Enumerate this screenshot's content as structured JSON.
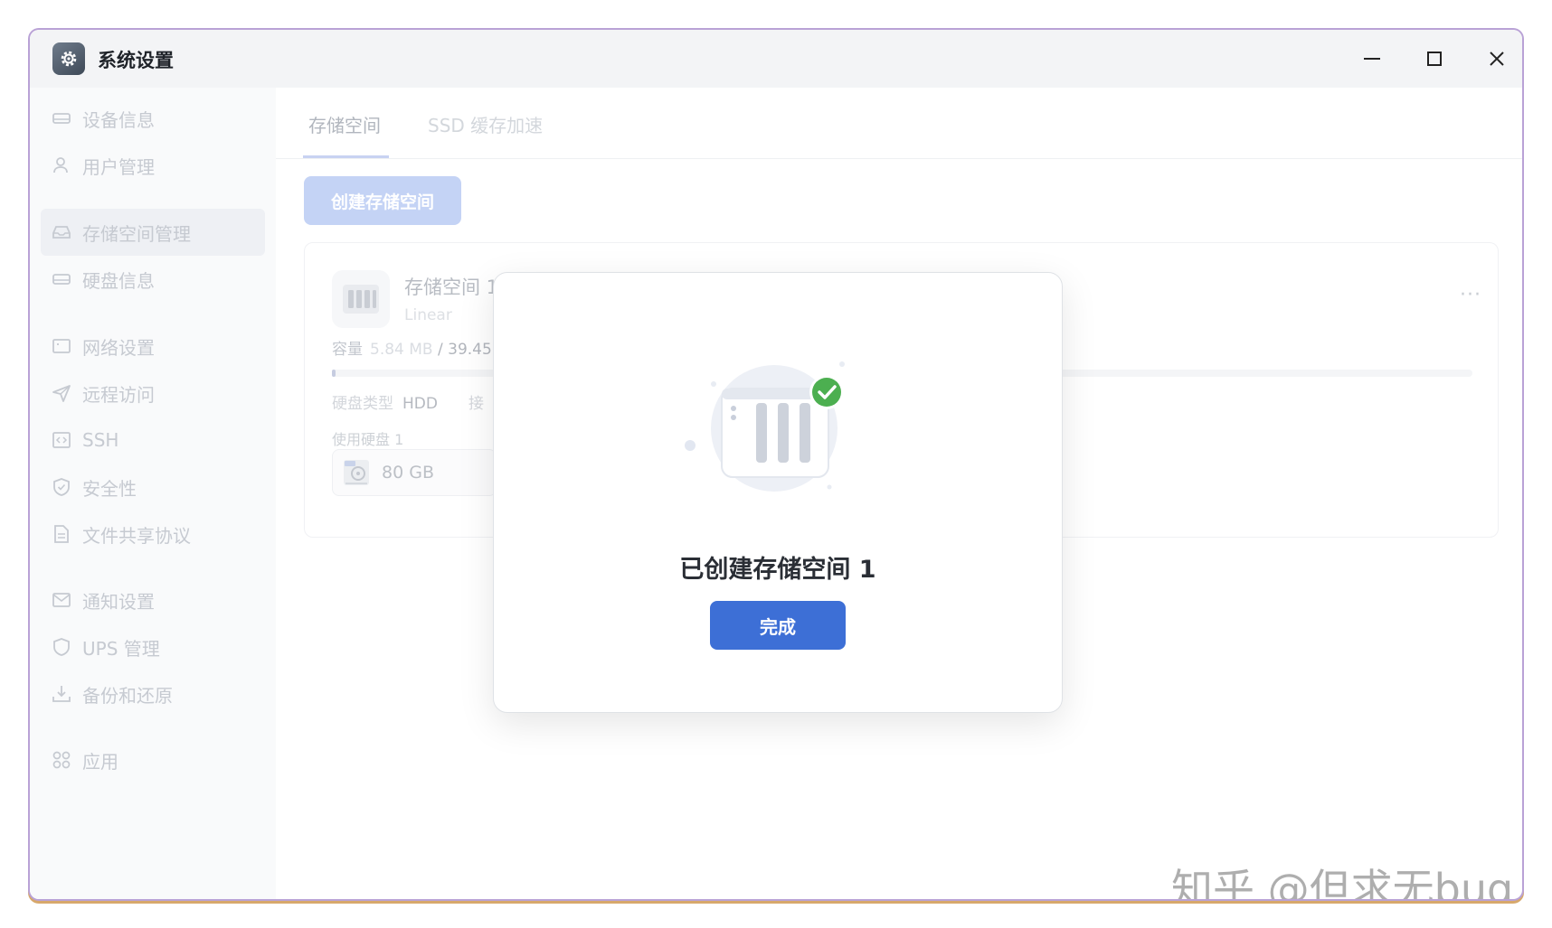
{
  "window": {
    "title": "系统设置",
    "icon": "gear-icon"
  },
  "sidebar": {
    "items": [
      {
        "label": "设备信息",
        "icon": "device-icon"
      },
      {
        "label": "用户管理",
        "icon": "user-icon"
      },
      {
        "label": "存储空间管理",
        "icon": "storage-icon",
        "active": true
      },
      {
        "label": "硬盘信息",
        "icon": "disk-icon"
      },
      {
        "label": "网络设置",
        "icon": "network-icon"
      },
      {
        "label": "远程访问",
        "icon": "send-icon"
      },
      {
        "label": "SSH",
        "icon": "ssh-icon"
      },
      {
        "label": "安全性",
        "icon": "shield-check-icon"
      },
      {
        "label": "文件共享协议",
        "icon": "file-icon"
      },
      {
        "label": "通知设置",
        "icon": "mail-icon"
      },
      {
        "label": "UPS 管理",
        "icon": "shield-icon"
      },
      {
        "label": "备份和还原",
        "icon": "download-icon"
      },
      {
        "label": "应用",
        "icon": "apps-icon"
      }
    ]
  },
  "tabs": {
    "storage": "存储空间",
    "ssd_cache": "SSD 缓存加速"
  },
  "create_button": "创建存储空间",
  "card": {
    "name": "存储空间 1",
    "raid_type": "Linear",
    "capacity_label": "容量",
    "used": "5.84 MB",
    "total": "/ 39.45",
    "usage_fraction": 0.0002,
    "disk_type_label": "硬盘类型",
    "disk_type_value": "HDD",
    "disk_type_extra": "接",
    "used_disks_label": "使用硬盘 1",
    "disk_size": "80 GB",
    "more": "···"
  },
  "modal": {
    "title": "已创建存储空间 1",
    "done_button": "完成"
  },
  "watermark": "知乎 @但求无bug",
  "colors": {
    "accent": "#3d6fd6",
    "success": "#4caf50"
  }
}
